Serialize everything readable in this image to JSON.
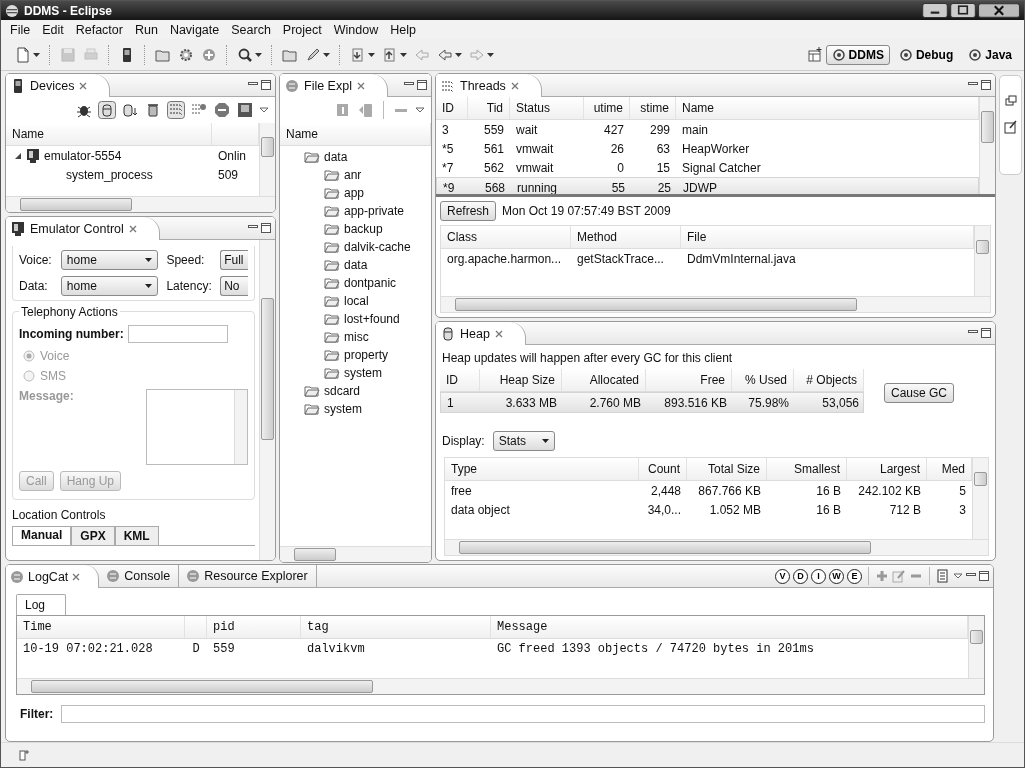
{
  "window": {
    "title": "DDMS - Eclipse"
  },
  "menu": [
    "File",
    "Edit",
    "Refactor",
    "Run",
    "Navigate",
    "Search",
    "Project",
    "Window",
    "Help"
  ],
  "perspectives": [
    {
      "label": "DDMS",
      "selected": true
    },
    {
      "label": "Debug",
      "selected": false
    },
    {
      "label": "Java",
      "selected": false
    }
  ],
  "devices": {
    "tab": "Devices",
    "toolbar": [
      {
        "kind": "bug",
        "pressed": false
      },
      {
        "kind": "heap",
        "pressed": true
      },
      {
        "kind": "dump",
        "pressed": false
      },
      {
        "kind": "trash",
        "pressed": false
      },
      {
        "kind": "threads",
        "pressed": true
      },
      {
        "kind": "threadstop",
        "pressed": false
      },
      {
        "kind": "stop",
        "pressed": false
      },
      {
        "kind": "screen",
        "pressed": false
      }
    ],
    "columns": [
      "Name"
    ],
    "tree": [
      {
        "name": "emulator-5554",
        "status": "Onlin",
        "expanded": true,
        "children": [
          {
            "name": "system_process",
            "status": "509"
          }
        ]
      }
    ]
  },
  "emulator_control": {
    "tab": "Emulator Control",
    "voice": {
      "label": "Voice:",
      "value": "home"
    },
    "speed": {
      "label": "Speed:",
      "value": "Full"
    },
    "data": {
      "label": "Data:",
      "value": "home"
    },
    "latency": {
      "label": "Latency:",
      "value": "No"
    },
    "actions_title": "Telephony Actions",
    "incoming_label": "Incoming number:",
    "radios": [
      {
        "label": "Voice",
        "selected": true
      },
      {
        "label": "SMS",
        "selected": false
      }
    ],
    "message_label": "Message:",
    "buttons": [
      "Call",
      "Hang Up"
    ],
    "actions_disabled": true,
    "location_title": "Location Controls",
    "location_tabs": [
      {
        "label": "Manual",
        "selected": true
      },
      {
        "label": "GPX",
        "selected": false
      },
      {
        "label": "KML",
        "selected": false
      }
    ]
  },
  "file_explorer": {
    "tab": "File Expl",
    "columns": [
      "Name"
    ],
    "tree": [
      {
        "name": "data",
        "children": [
          {
            "name": "anr"
          },
          {
            "name": "app"
          },
          {
            "name": "app-private"
          },
          {
            "name": "backup"
          },
          {
            "name": "dalvik-cache"
          },
          {
            "name": "data"
          },
          {
            "name": "dontpanic"
          },
          {
            "name": "local"
          },
          {
            "name": "lost+found"
          },
          {
            "name": "misc"
          },
          {
            "name": "property"
          },
          {
            "name": "system"
          }
        ]
      },
      {
        "name": "sdcard"
      },
      {
        "name": "system"
      }
    ]
  },
  "threads": {
    "tab": "Threads",
    "columns": [
      "ID",
      "Tid",
      "Status",
      "utime",
      "stime",
      "Name"
    ],
    "rows": [
      {
        "cells": [
          "3",
          "559",
          "wait",
          "427",
          "299",
          "main"
        ],
        "selected": false
      },
      {
        "cells": [
          "*5",
          "561",
          "vmwait",
          "26",
          "63",
          "HeapWorker"
        ],
        "selected": false
      },
      {
        "cells": [
          "*7",
          "562",
          "vmwait",
          "0",
          "15",
          "Signal Catcher"
        ],
        "selected": false
      },
      {
        "cells": [
          "*9",
          "568",
          "running",
          "55",
          "25",
          "JDWP"
        ],
        "selected": true
      }
    ],
    "refresh": "Refresh",
    "timestamp": "Mon Oct 19 07:57:49 BST 2009",
    "stack_columns": [
      "Class",
      "Method",
      "File"
    ],
    "stack_rows": [
      [
        "org.apache.harmon...",
        "getStackTrace...",
        "DdmVmInternal.java"
      ]
    ]
  },
  "heap": {
    "tab": "Heap",
    "note": "Heap updates will happen after every GC for this client",
    "columns": [
      "ID",
      "Heap Size",
      "Allocated",
      "Free",
      "% Used",
      "# Objects"
    ],
    "rows": [
      {
        "cells": [
          "1",
          "3.633 MB",
          "2.760 MB",
          "893.516 KB",
          "75.98%",
          "53,056"
        ],
        "selected": true
      }
    ],
    "cause_gc": "Cause GC",
    "display_label": "Display:",
    "display_value": "Stats",
    "stat_columns": [
      "Type",
      "Count",
      "Total Size",
      "Smallest",
      "Largest",
      "Med"
    ],
    "stat_rows": [
      [
        "free",
        "2,448",
        "867.766 KB",
        "16 B",
        "242.102 KB",
        "5"
      ],
      [
        "data object",
        "34,0...",
        "1.052 MB",
        "16 B",
        "712 B",
        "3"
      ]
    ]
  },
  "bottom_tabs": [
    {
      "label": "LogCat",
      "selected": true
    },
    {
      "label": "Console",
      "selected": false
    },
    {
      "label": "Resource Explorer",
      "selected": false
    }
  ],
  "log_levels": [
    "V",
    "D",
    "I",
    "W",
    "E"
  ],
  "logcat": {
    "subtab": "Log",
    "columns": {
      "time": "Time",
      "pid": "pid",
      "tag": "tag",
      "message": "Message"
    },
    "rows": [
      {
        "time": "10-19 07:02:21.028",
        "level": "D",
        "pid": "559",
        "tag": "dalvikvm",
        "message": "GC freed 1393 objects / 74720 bytes in 201ms"
      }
    ],
    "filter_label": "Filter:"
  }
}
